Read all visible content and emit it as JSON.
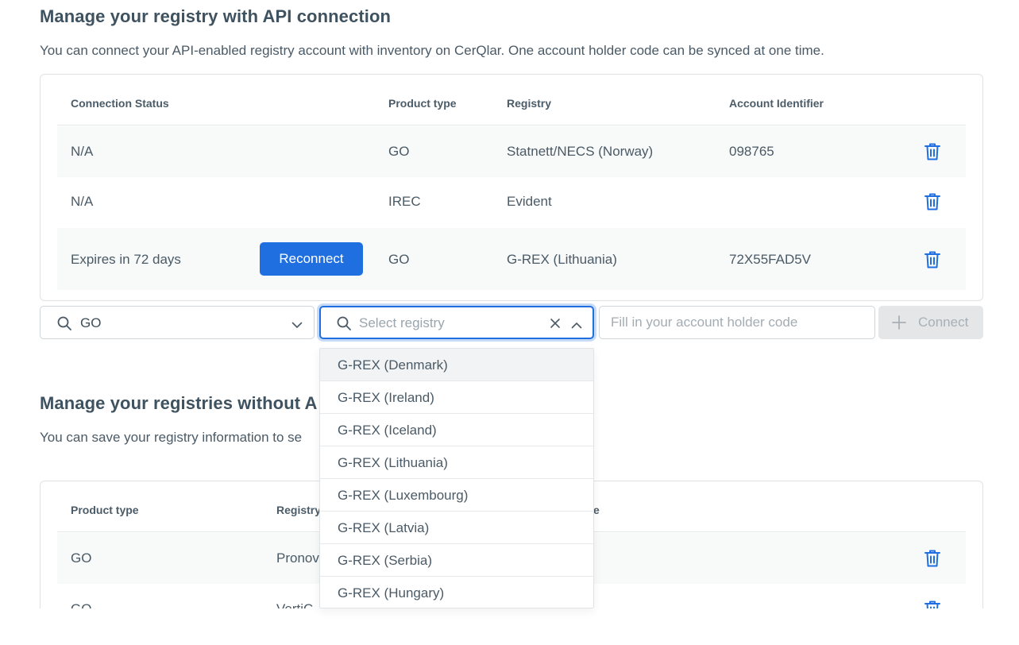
{
  "section_api": {
    "title": "Manage your registry with API connection",
    "description": "You can connect your API-enabled registry account with inventory on CerQlar. One account holder code can be synced at one time.",
    "columns": [
      "Connection Status",
      "Product type",
      "Registry",
      "Account Identifier"
    ],
    "rows": [
      {
        "status": "N/A",
        "product": "GO",
        "registry": "Statnett/NECS (Norway)",
        "account": "098765"
      },
      {
        "status": "N/A",
        "product": "IREC",
        "registry": "Evident",
        "account": ""
      },
      {
        "status": "Expires in 72 days",
        "product": "GO",
        "registry": "G-REX (Lithuania)",
        "account": "72X55FAD5V",
        "action": "Reconnect"
      }
    ]
  },
  "connect_form": {
    "product_value": "GO",
    "registry_placeholder": "Select registry",
    "account_placeholder": "Fill in your account holder code",
    "connect_label": "Connect"
  },
  "registry_options": [
    "G-REX (Denmark)",
    "G-REX (Ireland)",
    "G-REX (Iceland)",
    "G-REX (Lithuania)",
    "G-REX (Luxembourg)",
    "G-REX (Latvia)",
    "G-REX (Serbia)",
    "G-REX (Hungary)"
  ],
  "section_manual": {
    "title": "Manage your registries without A",
    "description": "You can save your registry information to se",
    "columns": [
      "Product type",
      "Registry",
      "e"
    ],
    "rows": [
      {
        "product": "GO",
        "registry": "Pronov"
      },
      {
        "product": "GO",
        "registry": "VertiC"
      }
    ]
  },
  "colors": {
    "accent": "#1f6fe0",
    "text": "#3d4f5c"
  },
  "icons": {
    "delete": "trash-icon",
    "search": "search-icon",
    "chevron": "chevron-down-icon",
    "clear": "close-icon",
    "add": "plus-icon"
  }
}
